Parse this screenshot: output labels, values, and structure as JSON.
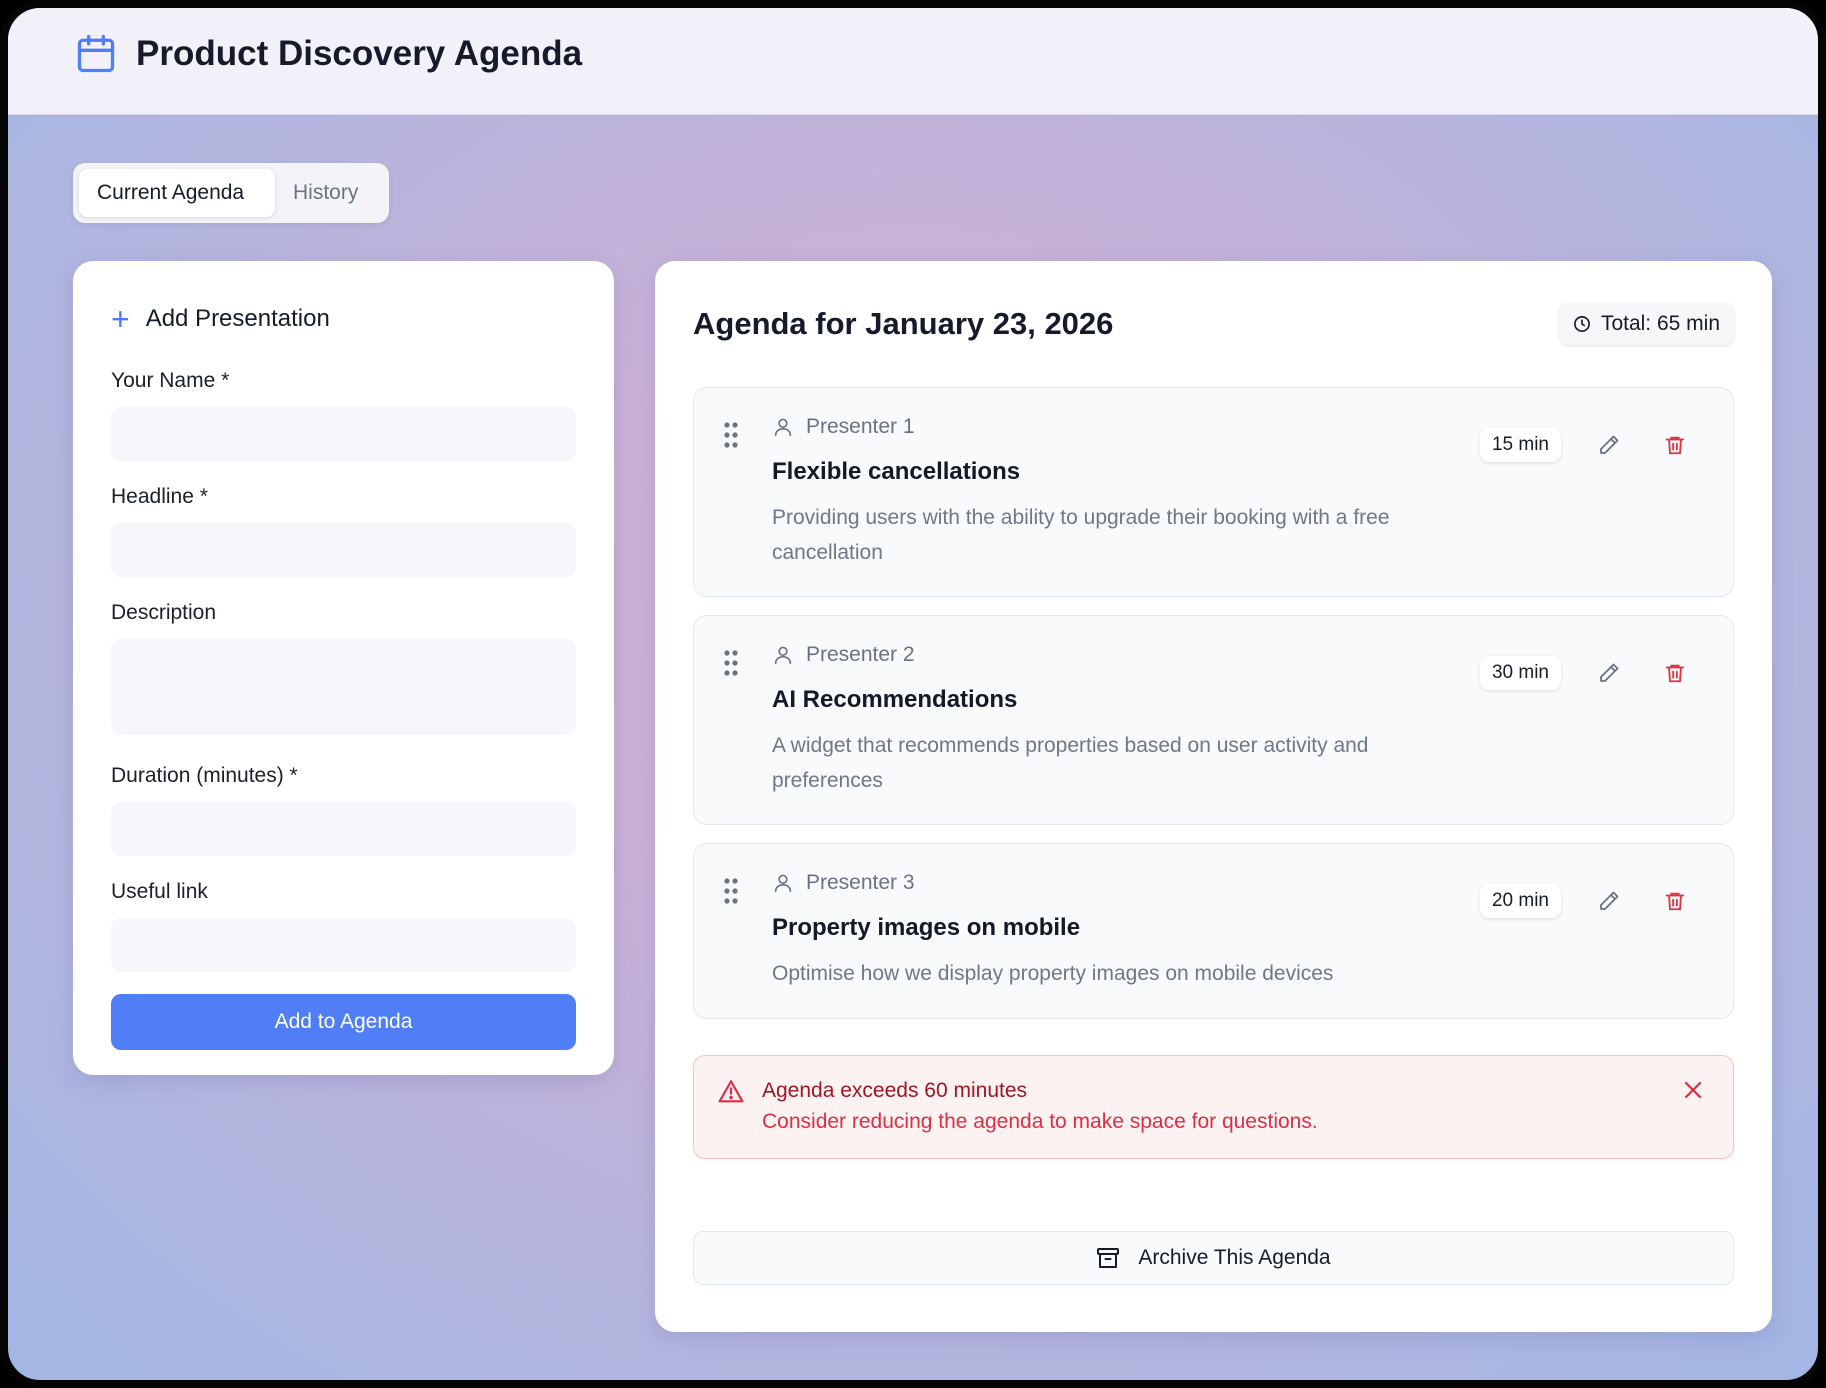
{
  "app": {
    "title": "Product Discovery Agenda",
    "icon": "calendar-icon",
    "accent": "#4f7ef7"
  },
  "tabs": [
    {
      "label": "Current Agenda",
      "active": true
    },
    {
      "label": "History",
      "active": false
    }
  ],
  "form": {
    "title": "Add Presentation",
    "fields": {
      "name": {
        "label": "Your Name *",
        "value": ""
      },
      "headline": {
        "label": "Headline *",
        "value": ""
      },
      "description": {
        "label": "Description",
        "value": ""
      },
      "duration": {
        "label": "Duration (minutes) *",
        "value": ""
      },
      "link": {
        "label": "Useful link",
        "value": ""
      }
    },
    "submit_label": "Add to Agenda"
  },
  "agenda": {
    "title": "Agenda for January 23, 2026",
    "total": "Total: 65 min",
    "items": [
      {
        "presenter": "Presenter 1",
        "title": "Flexible cancellations",
        "description": "Providing users with the ability to upgrade their booking with a free cancellation",
        "duration": "15 min"
      },
      {
        "presenter": "Presenter 2",
        "title": "AI Recommendations",
        "description": "A widget that recommends properties based on user activity and preferences",
        "duration": "30 min"
      },
      {
        "presenter": "Presenter 3",
        "title": "Property images on mobile",
        "description": "Optimise how we display property images on mobile devices",
        "duration": "20 min"
      }
    ],
    "alert": {
      "title": "Agenda exceeds 60 minutes",
      "text": "Consider reducing the agenda to make space for questions.",
      "color": "#dc2f45"
    },
    "archive_label": "Archive This Agenda"
  },
  "colors": {
    "delete": "#e0323f",
    "edit": "#6b7280"
  }
}
